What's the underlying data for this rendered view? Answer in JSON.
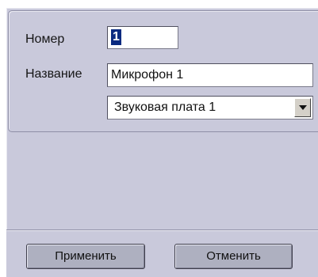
{
  "form": {
    "number_label": "Номер",
    "number_value": "1",
    "name_label": "Название",
    "name_value": "Микрофон 1",
    "device_value": "Звуковая плата 1"
  },
  "footer": {
    "apply_label": "Применить",
    "cancel_label": "Отменить"
  },
  "icons": {
    "dropdown": "chevron-down-icon"
  },
  "colors": {
    "panel_bg": "#c9c9db",
    "button_bg": "#aeb0c0",
    "selection": "#0a2a80"
  }
}
